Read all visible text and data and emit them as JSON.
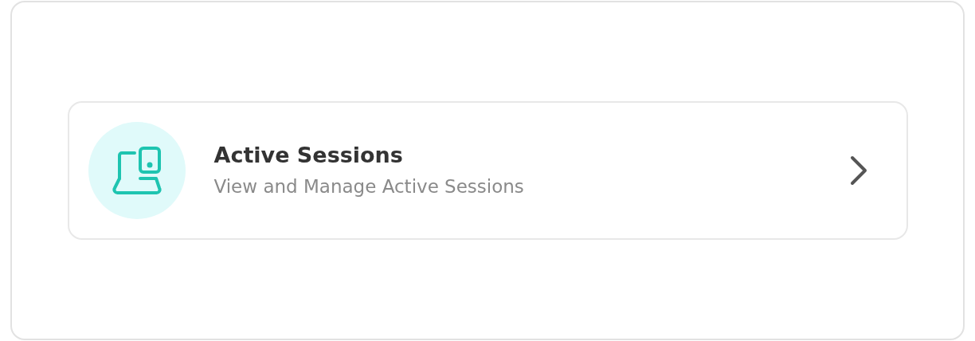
{
  "item": {
    "title": "Active Sessions",
    "subtitle": "View and Manage Active Sessions"
  }
}
